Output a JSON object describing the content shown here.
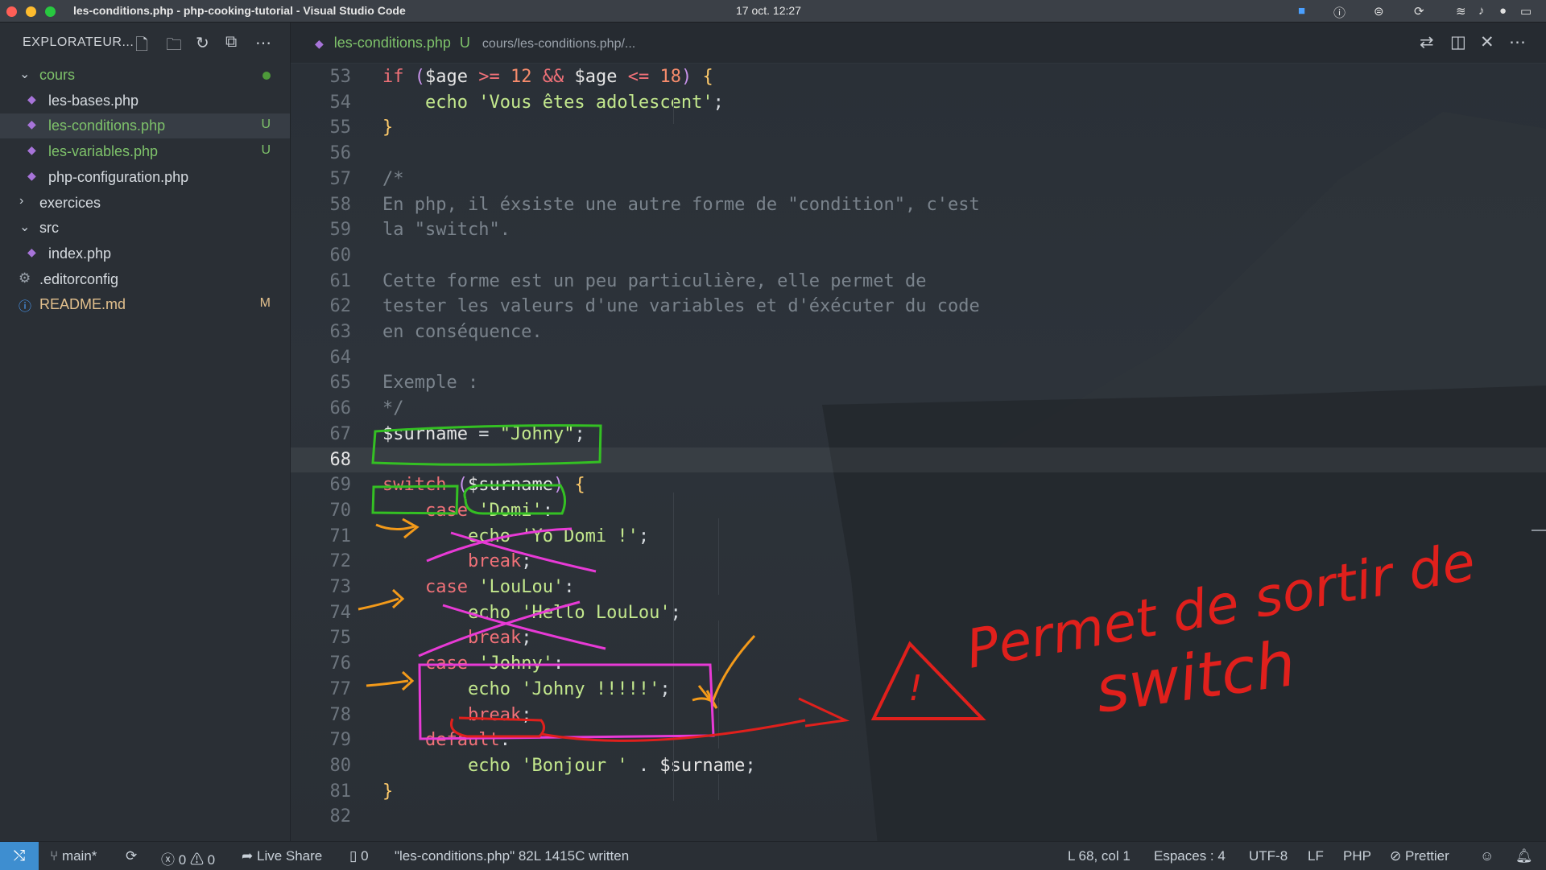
{
  "window": {
    "title": "les-conditions.php - php-cooking-tutorial - Visual Studio Code",
    "clock": "17 oct.  12:27"
  },
  "sidebar": {
    "title": "EXPLORATEUR...",
    "tree": [
      {
        "label": "cours",
        "type": "folder",
        "open": true,
        "color": "#7ec26a"
      },
      {
        "label": "les-bases.php",
        "type": "php"
      },
      {
        "label": "les-conditions.php",
        "type": "php",
        "status": "U",
        "color": "#7ec26a"
      },
      {
        "label": "les-variables.php",
        "type": "php",
        "status": "U",
        "color": "#7ec26a"
      },
      {
        "label": "php-configuration.php",
        "type": "php"
      },
      {
        "label": "exercices",
        "type": "folder",
        "open": false
      },
      {
        "label": "src",
        "type": "folder",
        "open": true
      },
      {
        "label": "index.php",
        "type": "php"
      },
      {
        "label": ".editorconfig",
        "type": "gear"
      },
      {
        "label": "README.md",
        "type": "info",
        "status": "M",
        "color": "#e2c08d"
      }
    ]
  },
  "tab": {
    "file": "les-conditions.php",
    "status": "U",
    "path": "cours/les-conditions.php/..."
  },
  "code": {
    "first_line": "52",
    "lines": [
      {
        "n": "53",
        "t": "if ($age >= 12 && $age <= 18) {"
      },
      {
        "n": "54",
        "t": "    echo 'Vous êtes adolescent';"
      },
      {
        "n": "55",
        "t": "}"
      },
      {
        "n": "56",
        "t": ""
      },
      {
        "n": "57",
        "t": "/*"
      },
      {
        "n": "58",
        "t": "En php, il éxsiste une autre forme de \"condition\", c'est"
      },
      {
        "n": "59",
        "t": "la \"switch\"."
      },
      {
        "n": "60",
        "t": ""
      },
      {
        "n": "61",
        "t": "Cette forme est un peu particulière, elle permet de"
      },
      {
        "n": "62",
        "t": "tester les valeurs d'une variables et d'éxécuter du code"
      },
      {
        "n": "63",
        "t": "en conséquence."
      },
      {
        "n": "64",
        "t": ""
      },
      {
        "n": "65",
        "t": "Exemple :"
      },
      {
        "n": "66",
        "t": "*/"
      },
      {
        "n": "67",
        "t": "$surname = \"Johny\";"
      },
      {
        "n": "68",
        "t": ""
      },
      {
        "n": "69",
        "t": "switch ($surname) {"
      },
      {
        "n": "70",
        "t": "    case 'Domi':"
      },
      {
        "n": "71",
        "t": "        echo 'Yo Domi !';"
      },
      {
        "n": "72",
        "t": "        break;"
      },
      {
        "n": "73",
        "t": "    case 'LouLou':"
      },
      {
        "n": "74",
        "t": "        echo 'Hello LouLou';"
      },
      {
        "n": "75",
        "t": "        break;"
      },
      {
        "n": "76",
        "t": "    case 'Johny':"
      },
      {
        "n": "77",
        "t": "        echo 'Johny !!!!!';"
      },
      {
        "n": "78",
        "t": "        break;"
      },
      {
        "n": "79",
        "t": "    default:"
      },
      {
        "n": "80",
        "t": "        echo 'Bonjour ' . $surname;"
      },
      {
        "n": "81",
        "t": "}"
      },
      {
        "n": "82",
        "t": ""
      }
    ]
  },
  "annotations": {
    "handwriting_line1": "Permet de sortir de",
    "handwriting_line2": "switch",
    "warning_mark": "!"
  },
  "statusbar": {
    "branch": "main*",
    "errors": "0",
    "warnings": "0",
    "live_share": "Live Share",
    "db": "0",
    "message": "\"les-conditions.php\" 82L 1415C written",
    "position": "L 68, col 1",
    "spaces": "Espaces : 4",
    "encoding": "UTF-8",
    "eol": "LF",
    "language": "PHP",
    "formatter": "Prettier"
  },
  "colors": {
    "accent": "#3e8ed0",
    "git_untracked": "#7ec26a",
    "git_modified": "#e2c08d",
    "annotation_red": "#e0201c",
    "annotation_green": "#34c023",
    "annotation_magenta": "#e83ad6",
    "annotation_orange": "#f39a1a"
  }
}
